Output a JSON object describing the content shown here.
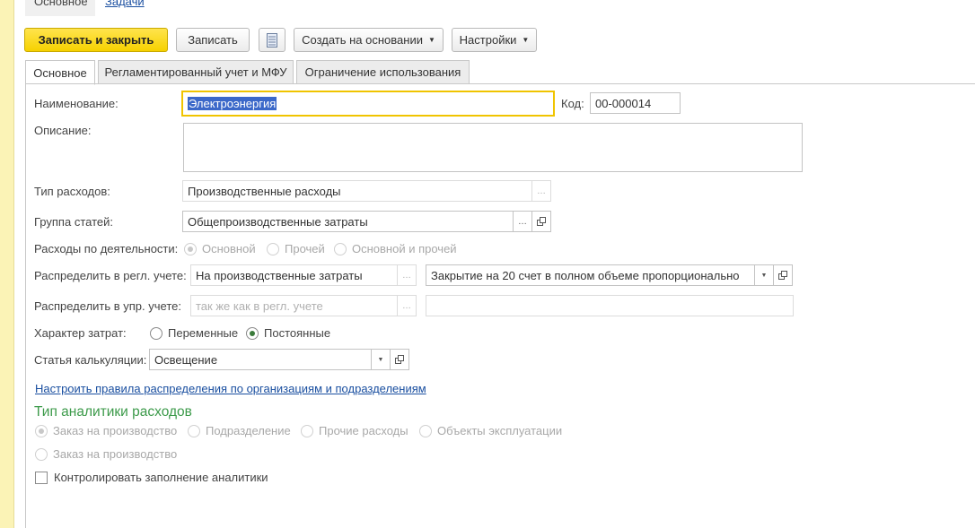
{
  "top_tabs": {
    "main": "Основное",
    "tasks": "Задачи"
  },
  "toolbar": {
    "save_close": "Записать и закрыть",
    "save": "Записать",
    "create_based": "Создать на основании",
    "settings": "Настройки"
  },
  "tabs": [
    {
      "label": "Основное"
    },
    {
      "label": "Регламентированный учет и МФУ"
    },
    {
      "label": "Ограничение использования"
    }
  ],
  "form": {
    "name_label": "Наименование:",
    "name_value": "Электроэнергия",
    "code_label": "Код:",
    "code_value": "00-000014",
    "description_label": "Описание:",
    "description_value": "",
    "expense_type_label": "Тип расходов:",
    "expense_type_value": "Производственные расходы",
    "item_group_label": "Группа статей:",
    "item_group_value": "Общепроизводственные затраты",
    "activity_label": "Расходы по деятельности:",
    "activity_options": [
      "Основной",
      "Прочей",
      "Основной и прочей"
    ],
    "distribute_reg_label": "Распределить в регл. учете:",
    "distribute_reg_value": "На производственные затраты",
    "distribute_reg_value2": "Закрытие на 20 счет в полном объеме пропорционально",
    "distribute_mgmt_label": "Распределить в упр. учете:",
    "distribute_mgmt_placeholder": "так же как в регл. учете",
    "cost_nature_label": "Характер затрат:",
    "cost_nature_options": [
      "Переменные",
      "Постоянные"
    ],
    "calc_item_label": "Статья калькуляции:",
    "calc_item_value": "Освещение",
    "setup_link": "Настроить правила распределения по организациям и подразделениям",
    "analytics_title": "Тип аналитики расходов",
    "analytics_options": [
      "Заказ на производство",
      "Подразделение",
      "Прочие расходы",
      "Объекты эксплуатации"
    ],
    "analytics_option_row2": "Заказ на производство",
    "control_checkbox": "Контролировать заполнение аналитики"
  },
  "icons": {
    "ellipsis": "…",
    "open": "open-icon",
    "dropdown": "chevron-down-icon",
    "table": "table-icon"
  }
}
